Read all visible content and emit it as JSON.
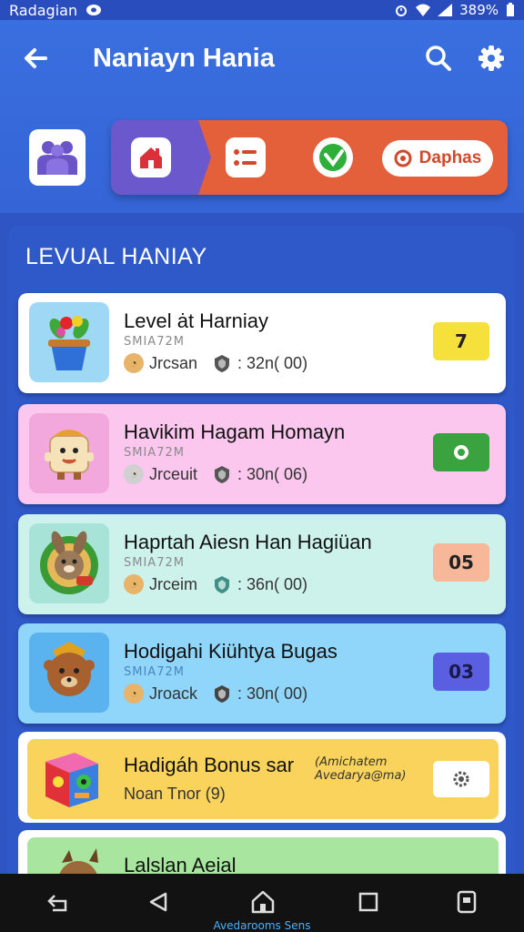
{
  "status_bar": {
    "carrier": "Radagian",
    "battery": "389%"
  },
  "app_bar": {
    "title": "Naniayn Hania",
    "back_icon": "arrow-left-icon",
    "search_icon": "search-icon",
    "settings_icon": "gear-icon"
  },
  "tabs": {
    "group_icon": "people-icon",
    "home_icon": "house-icon",
    "list_icon": "list-icon",
    "check_icon": "check-circle-icon",
    "pill_label": "Daphas"
  },
  "section": {
    "title": "LEVUAL HANIAY"
  },
  "levels": [
    {
      "title": "Level ȧt Harniay",
      "subtitle": "SMIA72M",
      "meta_name": "Jrcsan",
      "meta_value": ": 32n( 00)",
      "badge": "7",
      "badge_color": "#f5e03c",
      "bg": "#ffffff",
      "thumb_bg": "#9fd8f5"
    },
    {
      "title": "Havikim Hagam Homayn",
      "subtitle": "SMIA72M",
      "meta_name": "Jrceuit",
      "meta_value": ": 30n( 06)",
      "badge": "",
      "badge_color": "#3aa23f",
      "bg": "#fcc7ee",
      "thumb_bg": "#f3a8dd"
    },
    {
      "title": "Haprtah Aiesn Han Hagiüan",
      "subtitle": "SMIA72M",
      "meta_name": "Jrceim",
      "meta_value": ": 36n( 00)",
      "badge": "05",
      "badge_color": "#f7b89a",
      "bg": "#cdf2ec",
      "thumb_bg": "#a8e3d8"
    },
    {
      "title": "Hodigahi Kiühtya Bugas",
      "subtitle": "SMIA72M",
      "meta_name": "Jroack",
      "meta_value": ": 30n( 00)",
      "badge": "03",
      "badge_color": "#5a5ee0",
      "bg": "#8fd6fa",
      "thumb_bg": "#5ab3ef"
    }
  ],
  "bonus": {
    "title": "Hadigáh Bonus sar",
    "note": "(Amichatem Avedarya@ma)",
    "subtitle": "Noan Tnor (9)"
  },
  "peek": {
    "title": "Lalslan Aeial"
  },
  "nav": {
    "caption": "Avedarooms Sens"
  }
}
